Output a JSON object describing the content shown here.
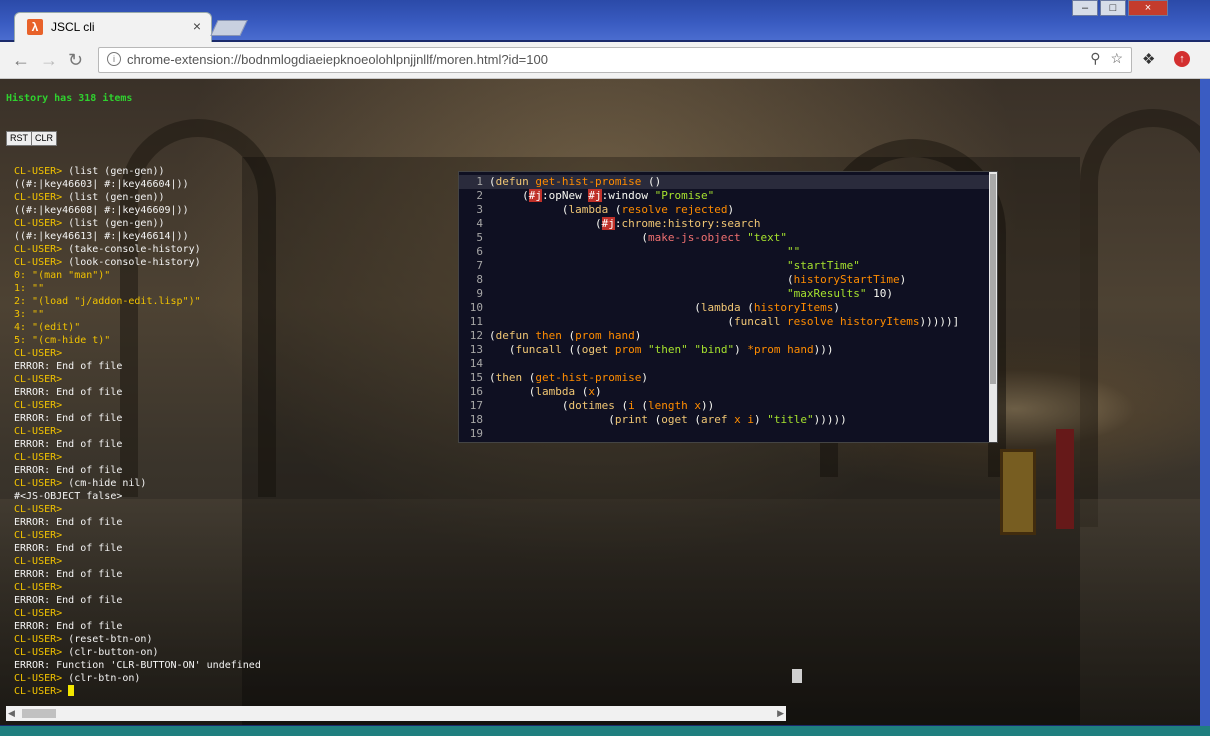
{
  "browser": {
    "tab_title": "JSCL cli",
    "tab_icon": "λ",
    "tab_close": "×",
    "url": "chrome-extension://bodnmlogdiaeiepknoeolohlpnjjnllf/moren.html?id=100",
    "window_buttons": [
      "–",
      "□",
      "×"
    ]
  },
  "page": {
    "history_text": "History has 318 items",
    "rst_label": "RST",
    "clr_label": "CLR"
  },
  "console": {
    "lines": [
      {
        "p": "CL-USER> ",
        "t": "(list (gen-gen))"
      },
      {
        "p": "",
        "t": "((#:|key46603| #:|key46604|))"
      },
      {
        "p": "CL-USER> ",
        "t": "(list (gen-gen))"
      },
      {
        "p": "",
        "t": "((#:|key46608| #:|key46609|))"
      },
      {
        "p": "CL-USER> ",
        "t": "(list (gen-gen))"
      },
      {
        "p": "",
        "t": "((#:|key46613| #:|key46614|))"
      },
      {
        "p": "CL-USER> ",
        "t": "(take-console-history)"
      },
      {
        "p": "CL-USER> ",
        "t": "(look-console-history)"
      },
      {
        "p": "",
        "t": "0: \"(man \"man\")\"",
        "y": true
      },
      {
        "p": "",
        "t": "1: \"\"",
        "y": true
      },
      {
        "p": "",
        "t": "2: \"(load \"j/addon-edit.lisp\")\"",
        "y": true
      },
      {
        "p": "",
        "t": "3: \"\"",
        "y": true
      },
      {
        "p": "",
        "t": "4: \"(edit)\"",
        "y": true
      },
      {
        "p": "",
        "t": "5: \"(cm-hide t)\"",
        "y": true
      },
      {
        "p": "CL-USER> ",
        "t": ""
      },
      {
        "p": "",
        "t": "ERROR: End of file"
      },
      {
        "p": "CL-USER> ",
        "t": ""
      },
      {
        "p": "",
        "t": "ERROR: End of file"
      },
      {
        "p": "CL-USER> ",
        "t": ""
      },
      {
        "p": "",
        "t": "ERROR: End of file"
      },
      {
        "p": "CL-USER> ",
        "t": ""
      },
      {
        "p": "",
        "t": "ERROR: End of file"
      },
      {
        "p": "CL-USER> ",
        "t": ""
      },
      {
        "p": "",
        "t": "ERROR: End of file"
      },
      {
        "p": "CL-USER> ",
        "t": "(cm-hide nil)"
      },
      {
        "p": "",
        "t": "#<JS-OBJECT false>"
      },
      {
        "p": "CL-USER> ",
        "t": ""
      },
      {
        "p": "",
        "t": "ERROR: End of file"
      },
      {
        "p": "CL-USER> ",
        "t": ""
      },
      {
        "p": "",
        "t": "ERROR: End of file"
      },
      {
        "p": "CL-USER> ",
        "t": ""
      },
      {
        "p": "",
        "t": "ERROR: End of file"
      },
      {
        "p": "CL-USER> ",
        "t": ""
      },
      {
        "p": "",
        "t": "ERROR: End of file"
      },
      {
        "p": "CL-USER> ",
        "t": ""
      },
      {
        "p": "",
        "t": "ERROR: End of file"
      },
      {
        "p": "CL-USER> ",
        "t": "(reset-btn-on)"
      },
      {
        "p": "CL-USER> ",
        "t": "(clr-button-on)"
      },
      {
        "p": "",
        "t": "ERROR: Function 'CLR-BUTTON-ON' undefined"
      },
      {
        "p": "CL-USER> ",
        "t": "(clr-btn-on)"
      },
      {
        "p": "CL-USER> ",
        "t": "",
        "cursor": true
      }
    ]
  },
  "editor": {
    "lines": [
      [
        [
          "",
          "("
        ],
        [
          "k",
          "defun"
        ],
        [
          "",
          " "
        ],
        [
          "f",
          "get-hist-promise"
        ],
        [
          "",
          " ()"
        ]
      ],
      [
        [
          "",
          "     ("
        ],
        [
          "hx",
          "#j"
        ],
        [
          "",
          ":opNew "
        ],
        [
          "hx",
          "#j"
        ],
        [
          "",
          ":window "
        ],
        [
          "s",
          "\"Promise\""
        ]
      ],
      [
        [
          "",
          "           ("
        ],
        [
          "k",
          "lambda"
        ],
        [
          "",
          " ("
        ],
        [
          "f",
          "resolve"
        ],
        [
          "",
          " "
        ],
        [
          "f",
          "rejected"
        ],
        [
          "",
          ")"
        ]
      ],
      [
        [
          "",
          "                ("
        ],
        [
          "hx",
          "#j"
        ],
        [
          "",
          ":"
        ],
        [
          "k",
          "chrome:history:search"
        ]
      ],
      [
        [
          "",
          "                       ("
        ],
        [
          "v",
          "make-js-object"
        ],
        [
          "",
          " "
        ],
        [
          "s",
          "\"text\""
        ]
      ],
      [
        [
          "",
          "                                             "
        ],
        [
          "s",
          "\"\""
        ]
      ],
      [
        [
          "",
          "                                             "
        ],
        [
          "s",
          "\"startTime\""
        ]
      ],
      [
        [
          "",
          "                                             ("
        ],
        [
          "f",
          "historyStartTime"
        ],
        [
          "",
          ")"
        ]
      ],
      [
        [
          "",
          "                                             "
        ],
        [
          "s",
          "\"maxResults\""
        ],
        [
          "",
          " 10)"
        ]
      ],
      [
        [
          "",
          "                               ("
        ],
        [
          "k",
          "lambda"
        ],
        [
          "",
          " ("
        ],
        [
          "f",
          "historyItems"
        ],
        [
          "",
          ")"
        ]
      ],
      [
        [
          "",
          "                                    ("
        ],
        [
          "k",
          "funcall"
        ],
        [
          "",
          " "
        ],
        [
          "f",
          "resolve"
        ],
        [
          "",
          " "
        ],
        [
          "f",
          "historyItems"
        ],
        [
          "",
          ")))))]"
        ]
      ],
      [
        [
          "",
          "("
        ],
        [
          "k",
          "defun"
        ],
        [
          "",
          " "
        ],
        [
          "f",
          "then"
        ],
        [
          "",
          " ("
        ],
        [
          "f",
          "prom"
        ],
        [
          "",
          " "
        ],
        [
          "f",
          "hand"
        ],
        [
          "",
          ")"
        ]
      ],
      [
        [
          "",
          "   ("
        ],
        [
          "k",
          "funcall"
        ],
        [
          "",
          " (("
        ],
        [
          "k",
          "oget"
        ],
        [
          "",
          " "
        ],
        [
          "f",
          "prom"
        ],
        [
          "",
          " "
        ],
        [
          "s",
          "\"then\""
        ],
        [
          "",
          " "
        ],
        [
          "s",
          "\"bind\""
        ],
        [
          "",
          ") "
        ],
        [
          "f",
          "*prom"
        ],
        [
          "",
          " "
        ],
        [
          "f",
          "hand"
        ],
        [
          "",
          ")))"
        ]
      ],
      [
        [
          "",
          ""
        ]
      ],
      [
        [
          "",
          "("
        ],
        [
          "k",
          "then"
        ],
        [
          "",
          " ("
        ],
        [
          "f",
          "get-hist-promise"
        ],
        [
          "",
          ")"
        ]
      ],
      [
        [
          "",
          "      ("
        ],
        [
          "k",
          "lambda"
        ],
        [
          "",
          " ("
        ],
        [
          "f",
          "x"
        ],
        [
          "",
          ")"
        ]
      ],
      [
        [
          "",
          "           ("
        ],
        [
          "k",
          "dotimes"
        ],
        [
          "",
          " ("
        ],
        [
          "f",
          "i"
        ],
        [
          "",
          " ("
        ],
        [
          "f",
          "length"
        ],
        [
          "",
          " "
        ],
        [
          "f",
          "x"
        ],
        [
          "",
          "))"
        ]
      ],
      [
        [
          "",
          "                  ("
        ],
        [
          "k",
          "print"
        ],
        [
          "",
          " ("
        ],
        [
          "k",
          "oget"
        ],
        [
          "",
          " ("
        ],
        [
          "k",
          "aref"
        ],
        [
          "",
          " "
        ],
        [
          "f",
          "x"
        ],
        [
          "",
          " "
        ],
        [
          "f",
          "i"
        ],
        [
          "",
          ") "
        ],
        [
          "s",
          "\"title\""
        ],
        [
          "",
          ")))))"
        ]
      ],
      [
        [
          "",
          ""
        ]
      ]
    ]
  }
}
